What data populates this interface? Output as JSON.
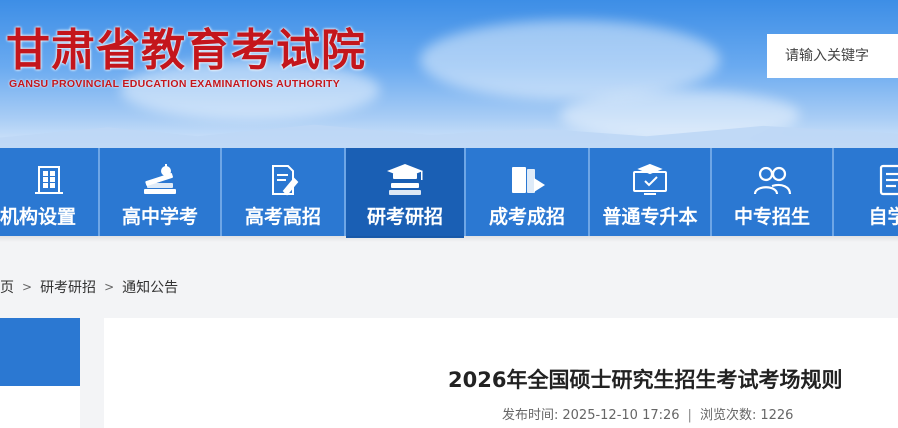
{
  "header": {
    "title": "甘肃省教育考试院",
    "subtitle": "GANSU PROVINCIAL EDUCATION EXAMINATIONS AUTHORITY",
    "search_placeholder": "请输入关键字"
  },
  "nav": {
    "items": [
      {
        "label": "机构设置",
        "icon": "building-icon",
        "active": false
      },
      {
        "label": "高中学考",
        "icon": "books-apple-icon",
        "active": false
      },
      {
        "label": "高考高招",
        "icon": "document-pen-icon",
        "active": false
      },
      {
        "label": "研考研招",
        "icon": "graduation-cap-icon",
        "active": true
      },
      {
        "label": "成考成招",
        "icon": "book-play-icon",
        "active": false
      },
      {
        "label": "普通专升本",
        "icon": "monitor-cap-icon",
        "active": false
      },
      {
        "label": "中专招生",
        "icon": "users-icon",
        "active": false
      },
      {
        "label": "自学考",
        "icon": "document-icon",
        "active": false
      }
    ]
  },
  "breadcrumb": {
    "home": "首页",
    "level1": "研考研招",
    "level2": "通知公告",
    "separator": ">"
  },
  "article": {
    "title": "2026年全国硕士研究生招生考试考场规则",
    "publish_label": "发布时间:",
    "publish_time": "2025-12-10 17:26",
    "views_label": "浏览次数:",
    "views": "1226"
  },
  "colors": {
    "brand_red": "#c4161c",
    "nav_blue": "#2b78d2",
    "nav_active": "#1a5fb4"
  }
}
